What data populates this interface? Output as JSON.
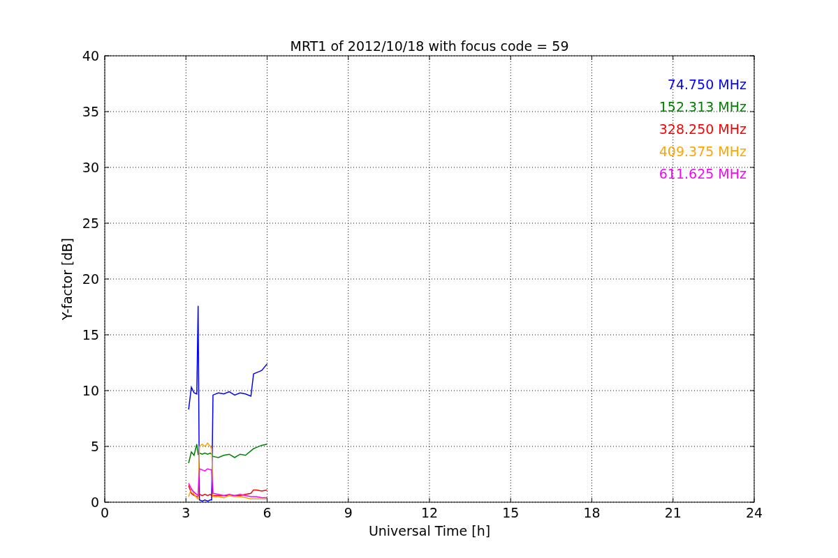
{
  "chart_data": {
    "type": "line",
    "title": "MRT1 of 2012/10/18 with focus code = 59",
    "xlabel": "Universal Time [h]",
    "ylabel": "Y-factor [dB]",
    "x": [
      3.1,
      3.2,
      3.3,
      3.4,
      3.45,
      3.5,
      3.6,
      3.7,
      3.8,
      3.9,
      3.95,
      4.0,
      4.2,
      4.4,
      4.6,
      4.8,
      5.0,
      5.2,
      5.4,
      5.5,
      5.6,
      5.8,
      6.0
    ],
    "series": [
      {
        "name": "74.750 MHz",
        "color": "#0000ff",
        "values": [
          8.3,
          10.3,
          9.8,
          9.7,
          17.6,
          0.2,
          0.1,
          0.2,
          0.1,
          0.2,
          0.2,
          9.6,
          9.8,
          9.7,
          9.9,
          9.6,
          9.8,
          9.7,
          9.5,
          11.5,
          11.6,
          11.8,
          12.4
        ]
      },
      {
        "name": "152.313 MHz",
        "color": "#008000",
        "values": [
          3.5,
          4.5,
          4.2,
          5.2,
          4.3,
          4.4,
          4.3,
          4.4,
          4.3,
          4.4,
          4.3,
          4.1,
          4.0,
          4.2,
          4.3,
          4.0,
          4.3,
          4.2,
          4.6,
          4.8,
          4.9,
          5.1,
          5.2
        ]
      },
      {
        "name": "328.250 MHz",
        "color": "#ff0000",
        "values": [
          1.5,
          0.8,
          0.6,
          0.5,
          0.5,
          0.7,
          0.6,
          0.7,
          0.6,
          0.7,
          0.6,
          0.6,
          0.6,
          0.6,
          0.6,
          0.6,
          0.6,
          0.7,
          0.8,
          1.1,
          1.1,
          1.0,
          1.1
        ]
      },
      {
        "name": "409.375 MHz",
        "color": "#ffa500",
        "values": [
          0.5,
          1.2,
          0.7,
          0.4,
          0.3,
          5.0,
          5.2,
          5.0,
          5.3,
          5.0,
          4.8,
          0.5,
          0.5,
          0.4,
          0.6,
          0.5,
          0.5,
          0.4,
          0.3,
          0.3,
          0.3,
          0.3,
          0.3
        ]
      },
      {
        "name": "611.625 MHz",
        "color": "#ff00ff",
        "values": [
          1.7,
          1.2,
          0.9,
          0.7,
          0.6,
          3.0,
          2.9,
          2.8,
          3.0,
          2.9,
          2.9,
          0.8,
          0.7,
          0.6,
          0.7,
          0.6,
          0.7,
          0.6,
          0.5,
          0.5,
          0.5,
          0.4,
          0.4
        ]
      }
    ],
    "grid": true,
    "xlim": [
      0,
      24
    ],
    "ylim": [
      0,
      40
    ],
    "xticks": [
      0,
      3,
      6,
      9,
      12,
      15,
      18,
      21,
      24
    ],
    "yticks": [
      0,
      5,
      10,
      15,
      20,
      25,
      30,
      35,
      40
    ]
  }
}
